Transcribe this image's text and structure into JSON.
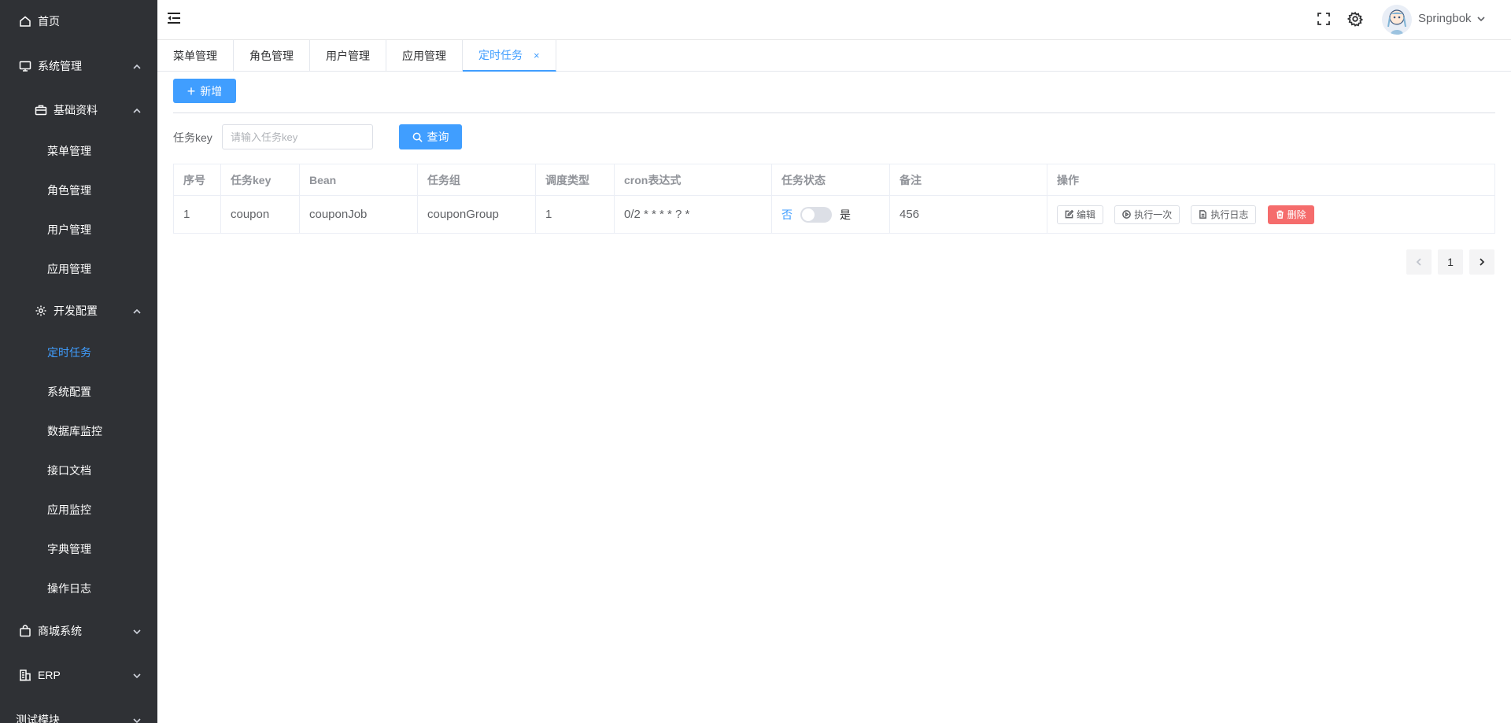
{
  "sidebar": {
    "items": [
      {
        "label": "首页",
        "icon": "home-icon"
      },
      {
        "label": "系统管理",
        "icon": "monitor-icon",
        "arrow": "up"
      },
      {
        "label": "基础资料",
        "icon": "briefcase-icon",
        "arrow": "up"
      },
      {
        "label": "菜单管理"
      },
      {
        "label": "角色管理"
      },
      {
        "label": "用户管理"
      },
      {
        "label": "应用管理"
      },
      {
        "label": "开发配置",
        "icon": "gear-icon",
        "arrow": "up"
      },
      {
        "label": "定时任务",
        "active": true
      },
      {
        "label": "系统配置"
      },
      {
        "label": "数据库监控"
      },
      {
        "label": "接口文档"
      },
      {
        "label": "应用监控"
      },
      {
        "label": "字典管理"
      },
      {
        "label": "操作日志"
      },
      {
        "label": "商城系统",
        "icon": "shopping-bag-icon",
        "arrow": "down"
      },
      {
        "label": "ERP",
        "icon": "building-icon",
        "arrow": "down"
      },
      {
        "label": "测试模块",
        "arrow": "down"
      }
    ]
  },
  "header": {
    "user_name": "Springbok"
  },
  "tabs": [
    {
      "label": "菜单管理"
    },
    {
      "label": "角色管理"
    },
    {
      "label": "用户管理"
    },
    {
      "label": "应用管理"
    },
    {
      "label": "定时任务",
      "active": true,
      "close": "×"
    }
  ],
  "toolbar": {
    "add_label": "新增"
  },
  "search": {
    "label": "任务key",
    "placeholder": "请输入任务key",
    "button_label": "查询"
  },
  "table": {
    "columns": [
      "序号",
      "任务key",
      "Bean",
      "任务组",
      "调度类型",
      "cron表达式",
      "任务状态",
      "备注",
      "操作"
    ],
    "rows": [
      {
        "index": "1",
        "task_key": "coupon",
        "bean": "couponJob",
        "group": "couponGroup",
        "schedule_type": "1",
        "cron": "0/2 * * * * ? *",
        "status_off": "否",
        "status_on": "是",
        "remark": "456",
        "actions": {
          "edit": "编辑",
          "run_once": "执行一次",
          "log": "执行日志",
          "delete": "删除"
        }
      }
    ]
  },
  "pagination": {
    "current_page": "1"
  },
  "colors": {
    "primary": "#409eff",
    "danger": "#f56c6c",
    "sidebar_bg": "#2f3135"
  }
}
